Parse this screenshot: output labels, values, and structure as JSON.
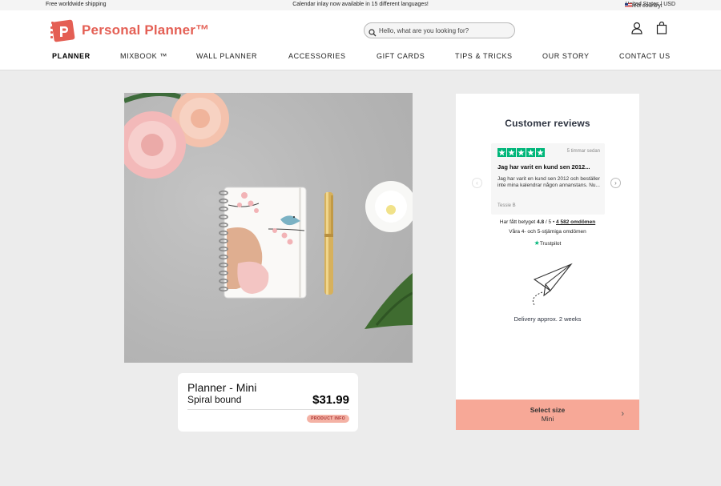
{
  "topbar": {
    "left": "Free worldwide shipping",
    "center": "Calendar inlay now available in 15 different languages!",
    "country_label": "Select country:",
    "country_value": "United States | USD"
  },
  "header": {
    "logo_text": "Personal Planner™",
    "search_placeholder": "Hello, what are you looking for?"
  },
  "nav": {
    "items": [
      {
        "label": "PLANNER"
      },
      {
        "label": "MIXBOOK ™"
      },
      {
        "label": "WALL PLANNER"
      },
      {
        "label": "ACCESSORIES"
      },
      {
        "label": "GIFT CARDS"
      },
      {
        "label": "TIPS & TRICKS"
      },
      {
        "label": "OUR STORY"
      },
      {
        "label": "CONTACT US"
      }
    ]
  },
  "product": {
    "title": "Planner - Mini",
    "binding": "Spiral bound",
    "price": "$31.99",
    "info_badge": "PRODUCT INFO"
  },
  "reviews": {
    "heading": "Customer reviews",
    "rating_stars": 5,
    "time": "5 timmar sedan",
    "review_title": "Jag har varit en kund sen 2012...",
    "review_body": "Jag har varit en kund sen 2012 och beställer inte mina kalendrar någon annanstans. Nu...",
    "author": "Tessie B",
    "score_prefix": "Har fått betyget",
    "score": "4.8",
    "score_mid": "/ 5 •",
    "count": "4 582 omdömen",
    "subtext": "Våra 4- och 5-stjärniga omdömen",
    "trustpilot": "Trustpilot",
    "prev_glyph": "‹",
    "next_glyph": "›"
  },
  "delivery": {
    "text": "Delivery approx. 2 weeks"
  },
  "select_size": {
    "label": "Select size",
    "value": "Mini",
    "chevron": "›"
  },
  "colors": {
    "brand": "#e45f54",
    "select_bg": "#f7a897",
    "trustpilot_green": "#00b67a"
  }
}
